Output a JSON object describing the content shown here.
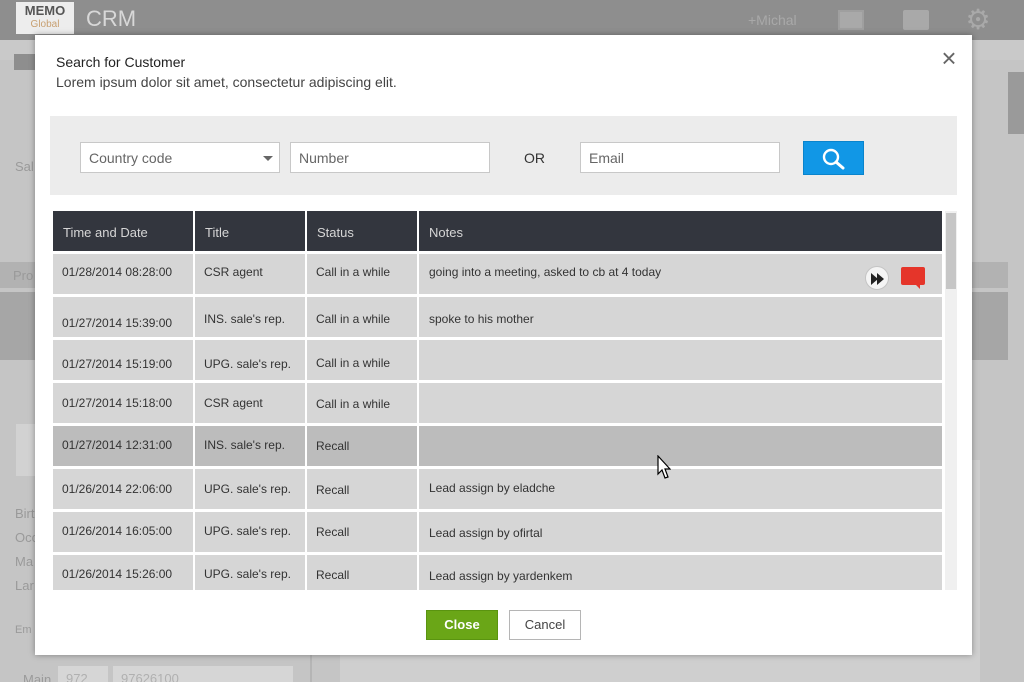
{
  "app": {
    "logo_line1": "MEMO",
    "logo_line2": "Global",
    "title": "CRM",
    "user": "+Michal",
    "bg_labels": [
      "Sal",
      "Pro",
      "Birt",
      "Occ",
      "Ma",
      "Lar",
      "Em",
      "Main",
      "972",
      "97626100"
    ]
  },
  "modal": {
    "title": "Search for Customer",
    "subtitle": "Lorem ipsum dolor sit amet, consectetur adipiscing elit.",
    "close_symbol": "×"
  },
  "search": {
    "country_placeholder": "Country code",
    "number_placeholder": "Number",
    "or_label": "OR",
    "email_placeholder": "Email"
  },
  "table": {
    "headers": [
      "Time and Date",
      "Title",
      "Status",
      "Notes"
    ],
    "rows": [
      {
        "date": "01/28/2014 08:28:00",
        "title": "CSR agent",
        "status": "Call in a while",
        "notes": "going into a meeting, asked to cb at 4 today"
      },
      {
        "date": "01/27/2014 15:39:00",
        "title": "INS. sale's rep.",
        "status": "Call in a while",
        "notes": "spoke to his mother"
      },
      {
        "date": "01/27/2014 15:19:00",
        "title": "UPG. sale's rep.",
        "status": "Call in a while",
        "notes": ""
      },
      {
        "date": "01/27/2014 15:18:00",
        "title": "CSR agent",
        "status": "Call in a while",
        "notes": ""
      },
      {
        "date": "01/27/2014 12:31:00",
        "title": "INS. sale's rep.",
        "status": "Recall",
        "notes": ""
      },
      {
        "date": "01/26/2014 22:06:00",
        "title": "UPG. sale's rep.",
        "status": "Recall",
        "notes": "Lead assign by eladche"
      },
      {
        "date": "01/26/2014 16:05:00",
        "title": "UPG. sale's rep.",
        "status": "Recall",
        "notes": "Lead assign by ofirtal"
      },
      {
        "date": "01/26/2014 15:26:00",
        "title": "UPG. sale's rep.",
        "status": "Recall",
        "notes": "Lead assign by yardenkem"
      }
    ]
  },
  "buttons": {
    "close": "Close",
    "cancel": "Cancel"
  },
  "colors": {
    "header_bg": "#33363e",
    "search_button": "#1197e6",
    "close_button": "#6aa617",
    "note_icon": "#e5352a"
  }
}
